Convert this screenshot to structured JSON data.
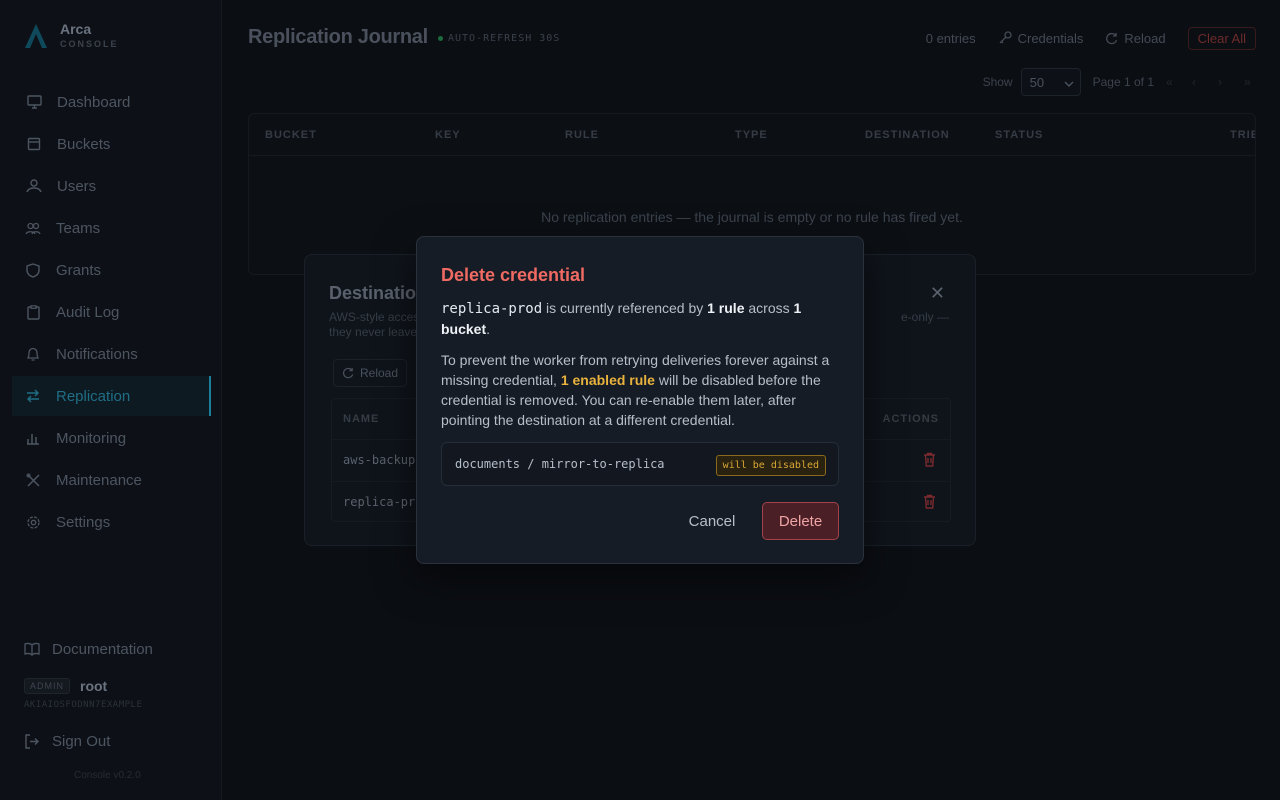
{
  "brand": {
    "name": "Arca",
    "sub": "CONSOLE"
  },
  "sidebar": {
    "items": [
      {
        "label": "Dashboard",
        "icon": "monitor-icon"
      },
      {
        "label": "Buckets",
        "icon": "bucket-icon"
      },
      {
        "label": "Users",
        "icon": "user-icon"
      },
      {
        "label": "Teams",
        "icon": "teams-icon"
      },
      {
        "label": "Grants",
        "icon": "shield-icon"
      },
      {
        "label": "Audit Log",
        "icon": "clipboard-icon"
      },
      {
        "label": "Notifications",
        "icon": "bell-icon"
      },
      {
        "label": "Replication",
        "icon": "replication-icon",
        "active": true
      },
      {
        "label": "Monitoring",
        "icon": "bar-chart-icon"
      },
      {
        "label": "Maintenance",
        "icon": "tools-icon"
      },
      {
        "label": "Settings",
        "icon": "gear-icon"
      }
    ],
    "documentation": "Documentation",
    "user": {
      "badge": "ADMIN",
      "name": "root",
      "access_key": "AKIAIOSFODNN7EXAMPLE"
    },
    "sign_out": "Sign Out",
    "version": "Console v0.2.0"
  },
  "header": {
    "title": "Replication Journal",
    "auto_refresh": "AUTO-REFRESH 30S",
    "entries": "0 entries",
    "credentials": "Credentials",
    "reload": "Reload",
    "clear_all": "Clear All"
  },
  "pager": {
    "show_label": "Show",
    "page_size": "50",
    "page_info": "Page 1 of 1"
  },
  "journal_table": {
    "columns": [
      "BUCKET",
      "KEY",
      "RULE",
      "TYPE",
      "DESTINATION",
      "STATUS",
      "TRIES"
    ],
    "empty": "No replication entries — the journal is empty or no rule has fired yet."
  },
  "destinations_modal": {
    "title": "Destinations",
    "desc_left": "AWS-style access",
    "desc_left_2": "they never leave",
    "desc_right": "e-only —",
    "reload": "Reload",
    "columns": {
      "name": "NAME",
      "actions": "ACTIONS"
    },
    "rows": [
      {
        "name": "aws-backup"
      },
      {
        "name": "replica-prod"
      }
    ]
  },
  "dialog": {
    "title": "Delete credential",
    "credential": "replica-prod",
    "p1_mid": " is currently referenced by ",
    "rule_count": "1 rule",
    "p1_across": " across ",
    "bucket_count": "1 bucket",
    "p1_end": ".",
    "p2_start": "To prevent the worker from retrying deliveries forever against a missing credential, ",
    "enabled_rules": "1 enabled rule",
    "p2_end": " will be disabled before the credential is removed. You can re-enable them later, after pointing the destination at a different credential.",
    "rule_path": "documents / mirror-to-replica",
    "rule_badge": "will be disabled",
    "cancel": "Cancel",
    "delete": "Delete"
  },
  "colors": {
    "danger": "#ef6a62",
    "warning": "#e8b23e",
    "accent": "#1c7f99"
  }
}
